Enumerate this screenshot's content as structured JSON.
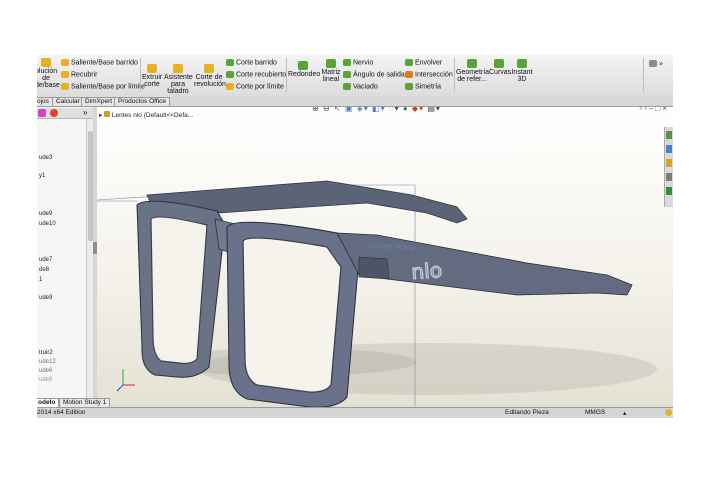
{
  "ribbon": {
    "revolve_label": "olución\nde\nde/base",
    "swept_boss": "Saliente/Base barrido",
    "wrap": "Recubrir",
    "boundary_boss": "Saliente/Base por límite",
    "extruded_cut": "Extruir\ncorte",
    "hole_wizard": "Asistente\npara\ntaladro",
    "revolved_cut": "Corte de\nrevolución",
    "swept_cut": "Corte barrido",
    "lofted_cut": "Corte recubierto",
    "boundary_cut": "Corte por límite",
    "fillet": "Redondeo",
    "linear_pattern": "Matriz\nlineal",
    "rib": "Nervio",
    "draft": "Ángulo de salida",
    "shell": "Vaciado",
    "wrap2": "Envolver",
    "intersect": "Intersección",
    "mirror": "Simetría",
    "ref_geometry": "Geometría\nde refer...",
    "curves": "Curvas",
    "instant3d": "Instant\n3D"
  },
  "tabs": [
    "ojos",
    "Calcular",
    "DimXpert",
    "Productos Office"
  ],
  "panel": {
    "items": [
      "ude3",
      "y1",
      "ude9",
      "ude10",
      "ude7",
      "de8",
      "1",
      "ude9",
      "truir2",
      "ude12",
      "ude6",
      "ude8"
    ]
  },
  "viewport": {
    "tree_label": "Lentes nlo  (Default<<Defa...",
    "plane_label": "Center Plane",
    "engraving": "nlo"
  },
  "bottom_tabs": [
    "odelo",
    "Motion Study 1"
  ],
  "status": {
    "edition": "2014 x64 Edition",
    "editing": "Editando Pieza",
    "units": "MMGS"
  }
}
